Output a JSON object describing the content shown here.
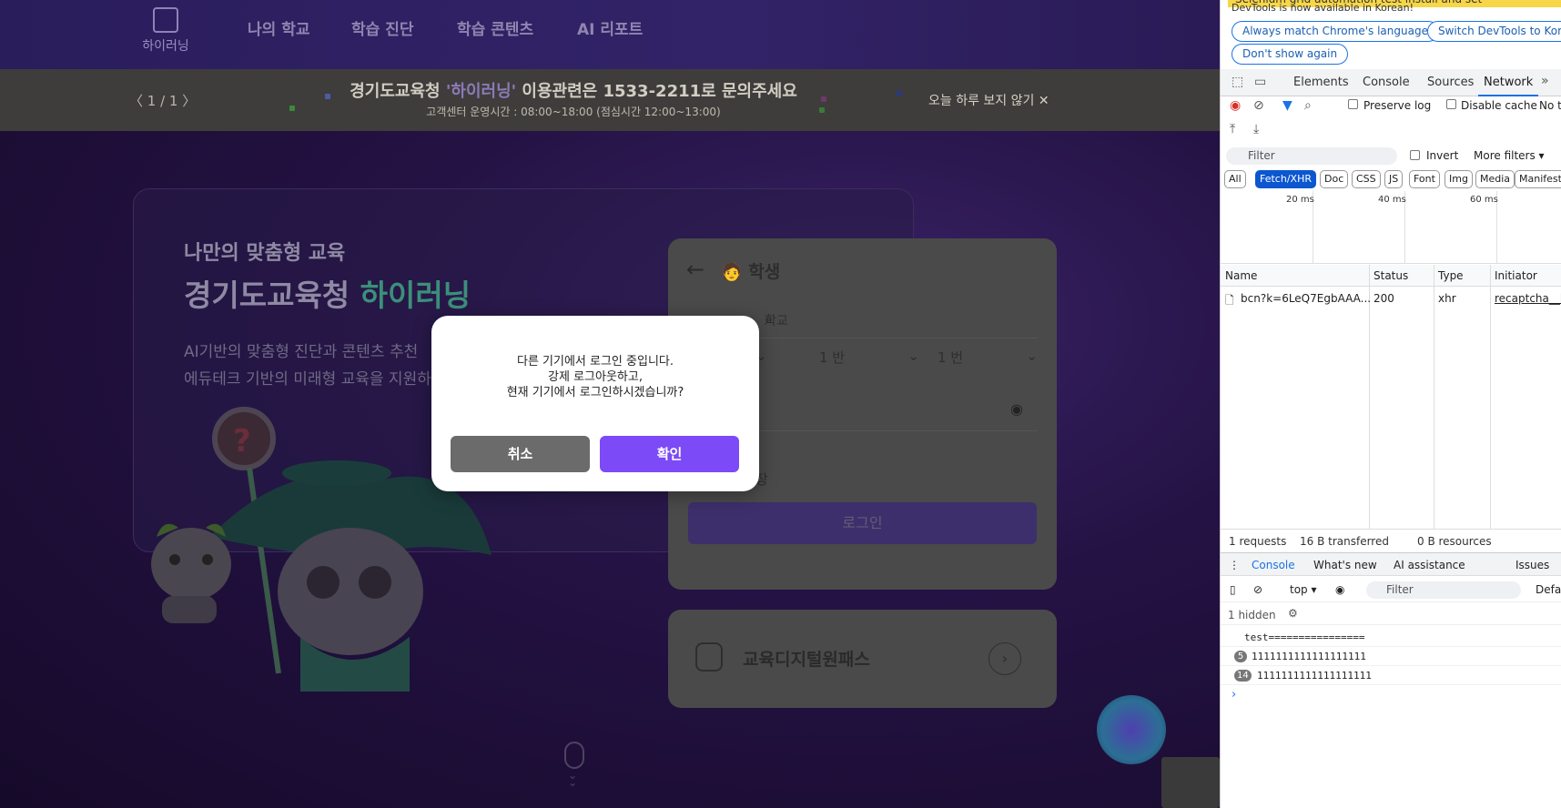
{
  "site": {
    "logo_text": "하이러닝",
    "nav": [
      "나의 학교",
      "학습 진단",
      "학습 콘텐츠",
      "AI 리포트"
    ],
    "banner": {
      "pager": "〈  1 / 1  〉",
      "headline_pre": "경기도교육청 ",
      "headline_brand": "'하이러닝'",
      "headline_post": " 이용관련은 1533-2211로 문의주세요",
      "sub": "고객센터 운영시간 : 08:00~18:00  (점심시간 12:00~13:00)",
      "close": "오늘 하루 보지 않기 ✕"
    },
    "hero": {
      "kicker": "나만의 맞춤형 교육",
      "title_pre": "경기도교육청 ",
      "title_brand": "하이러닝",
      "desc_line1": "AI기반의 맞춤형 진단과 콘텐츠 추천",
      "desc_line2": "에듀테크 기반의 미래형 교육을 지원하"
    },
    "login": {
      "back": "←",
      "role": "🧑 학생",
      "school_value": "학교",
      "class_select": "1 반",
      "number_select": "1 번",
      "grade_chevron": "⌄",
      "remember": "장",
      "login_button": "로그인"
    },
    "dpass": {
      "label": "교육디지털원패스",
      "go": "›"
    }
  },
  "modal": {
    "message": "다른 기기에서 로그인 중입니다.\n강제 로그아웃하고,\n현재 기기에서 로그인하시겠습니까?",
    "cancel": "취소",
    "confirm": "확인"
  },
  "devtools": {
    "notice": "DevTools is now available in Korean!",
    "notice_top": "Selenium grid automation test install and set",
    "pill_match": "Always match Chrome's language",
    "pill_switch": "Switch DevTools to Korea",
    "pill_dont": "Don't show again",
    "tabs": [
      "Elements",
      "Console",
      "Sources",
      "Network"
    ],
    "active_tab": "Network",
    "preserve_log": "Preserve log",
    "disable_cache": "Disable cache",
    "no_throttle": "No t",
    "filter_placeholder": "Filter",
    "invert": "Invert",
    "more_filters": "More filters ▾",
    "type_chips": [
      "All",
      "Fetch/XHR",
      "Doc",
      "CSS",
      "JS",
      "Font",
      "Img",
      "Media",
      "Manifest"
    ],
    "active_chip": "Fetch/XHR",
    "timeline": [
      "20 ms",
      "40 ms",
      "60 ms"
    ],
    "columns": [
      "Name",
      "Status",
      "Type",
      "Initiator"
    ],
    "request": {
      "name": "bcn?k=6LeQ7EgbAAA...",
      "status": "200",
      "type": "xhr",
      "initiator": "recaptcha__ko"
    },
    "summary": [
      "1 requests",
      "16 B transferred",
      "0 B resources"
    ],
    "drawer_tabs": [
      "Console",
      "What's new",
      "AI assistance",
      "Issues"
    ],
    "context": "top ▾",
    "console_filter": "Filter",
    "default_levels": "Defau",
    "hidden": "1 hidden",
    "logs": [
      {
        "count": "",
        "text": "test================"
      },
      {
        "count": "5",
        "text": "1111111111111111111"
      },
      {
        "count": "14",
        "text": "1111111111111111111"
      }
    ],
    "prompt": "›"
  }
}
